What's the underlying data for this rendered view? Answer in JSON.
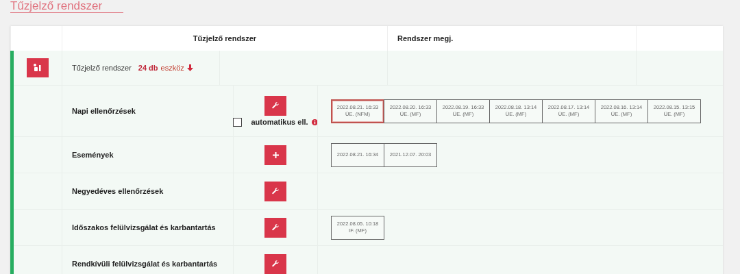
{
  "page_title": "Tűzjelző rendszer",
  "table": {
    "columns": [
      "Tűzjelző rendszer",
      "Rendszer megj."
    ],
    "group": {
      "name": "Tűzjelző rendszer",
      "count": "24 db",
      "unit": "eszköz",
      "expanded": true
    },
    "rows": [
      {
        "name": "Napi ellenőrzések",
        "kind": "wrench",
        "auto_check": {
          "label": "automatikus ell.",
          "checked": false
        },
        "records": [
          {
            "date": "2022.08.21. 16:33",
            "note": "ÜE. (NFM)",
            "selected": true
          },
          {
            "date": "2022.08.20. 16:33",
            "note": "ÜE. (MF)",
            "selected": false
          },
          {
            "date": "2022.08.19. 16:33",
            "note": "ÜE. (MF)",
            "selected": false
          },
          {
            "date": "2022.08.18. 13:14",
            "note": "ÜE. (MF)",
            "selected": false
          },
          {
            "date": "2022.08.17. 13:14",
            "note": "ÜE. (MF)",
            "selected": false
          },
          {
            "date": "2022.08.16. 13:14",
            "note": "ÜE. (MF)",
            "selected": false
          },
          {
            "date": "2022.08.15. 13:15",
            "note": "ÜE. (MF)",
            "selected": false
          }
        ]
      },
      {
        "name": "Események",
        "kind": "plus",
        "records": [
          {
            "date": "2022.08.21. 16:34",
            "selected": false
          },
          {
            "date": "2021.12.07. 20:03",
            "selected": false
          }
        ]
      },
      {
        "name": "Negyedéves ellenőrzések",
        "kind": "wrench",
        "records": []
      },
      {
        "name": "Időszakos felülvizsgálat és karbantartás",
        "kind": "wrench",
        "records": [
          {
            "date": "2022.08.05. 10:18",
            "note": "IF. (MF)",
            "selected": false
          }
        ]
      },
      {
        "name": "Rendkívüli felülvizsgálat és karbantartás",
        "kind": "wrench",
        "records": []
      }
    ]
  }
}
